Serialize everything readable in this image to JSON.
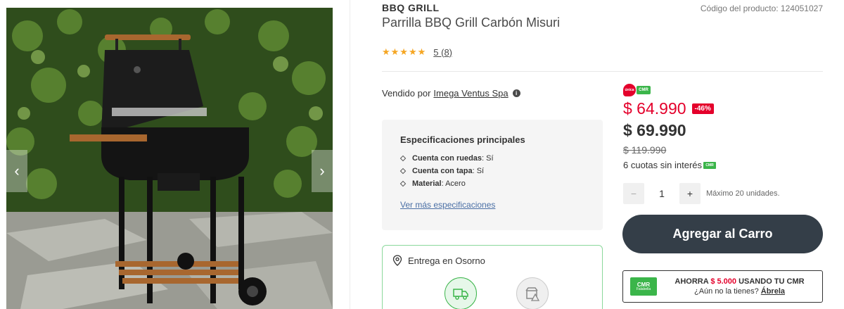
{
  "gallery": {
    "prev_arrow": "‹",
    "next_arrow": "›"
  },
  "product": {
    "brand": "BBQ GRILL",
    "code_label": "Código del producto: 124051027",
    "title": "Parrilla BBQ Grill Carbón Misuri",
    "stars": "★★★★★",
    "rating_text": "5 (8)"
  },
  "seller": {
    "label": "Vendido por",
    "name": "Imega Ventus Spa",
    "info_icon": "i"
  },
  "specs": {
    "title": "Especificaciones principales",
    "items": [
      {
        "key": "Cuenta con ruedas",
        "value": ": Sí"
      },
      {
        "key": "Cuenta con tapa",
        "value": ": Sí"
      },
      {
        "key": "Material",
        "value": ": Acero"
      }
    ],
    "link": "Ver más especificaciones"
  },
  "delivery": {
    "title": "Entrega en Osorno"
  },
  "price": {
    "unica_badge": "única",
    "cmr_badge": "CMR",
    "cmr_price": "$ 64.990",
    "discount": "-46%",
    "normal_price": "$ 69.990",
    "old_price": "$ 119.990",
    "cuotas": "6 cuotas sin interés",
    "cuotas_badge": "CMR"
  },
  "quantity": {
    "minus": "−",
    "value": "1",
    "plus": "+",
    "max_text": "Máximo 20 unidades."
  },
  "cart": {
    "button_label": "Agregar al Carro"
  },
  "cmr_promo": {
    "card_label": "CMR",
    "card_sub": "Falabella",
    "prefix": "AHORRA ",
    "amount": "$ 5.000",
    "suffix": " USANDO TU CMR",
    "question": "¿Aún no la tienes? ",
    "link": "Ábrela"
  },
  "colors": {
    "cmr_red": "#e4002b",
    "cmr_green": "#3bb54a",
    "button_dark": "#343e48",
    "star": "#f5a623"
  }
}
